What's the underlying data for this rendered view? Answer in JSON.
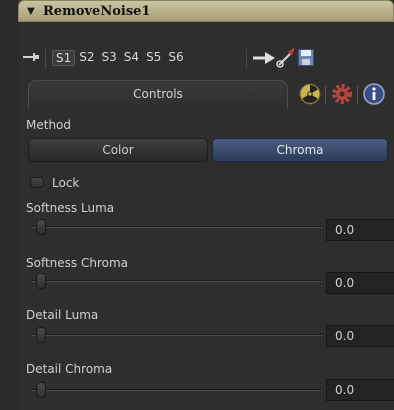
{
  "header": {
    "title": "RemoveNoise1"
  },
  "toolbar": {
    "slots": [
      "S1",
      "S2",
      "S3",
      "S4",
      "S5",
      "S6"
    ],
    "active_slot": "S1"
  },
  "tabs": {
    "controls_label": "Controls"
  },
  "method": {
    "label": "Method",
    "options": [
      "Color",
      "Chroma"
    ],
    "selected": "Chroma"
  },
  "lock": {
    "label": "Lock",
    "checked": false
  },
  "sliders": [
    {
      "label": "Softness Luma",
      "value": "0.0"
    },
    {
      "label": "Softness Chroma",
      "value": "0.0"
    },
    {
      "label": "Detail Luma",
      "value": "0.0"
    },
    {
      "label": "Detail Chroma",
      "value": "0.0"
    }
  ],
  "colors": {
    "header": "#b8b08a",
    "selected_button": "#3a4a6e",
    "background": "#2e2e2e"
  }
}
